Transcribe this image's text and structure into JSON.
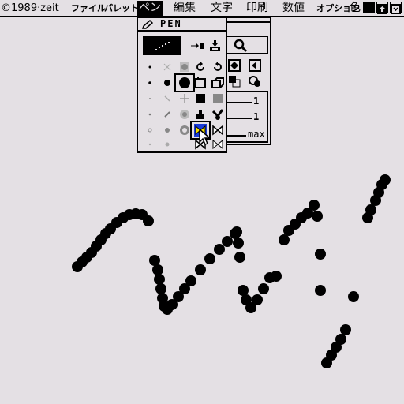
{
  "menubar": {
    "copyright": "©1989·zeit",
    "file": "ファイル",
    "palette": "パレット",
    "pen": "ペン",
    "edit": "編集",
    "text": "文字",
    "print": "印刷",
    "numeric": "数値",
    "option": "オプション",
    "color": "色"
  },
  "pen_palette": {
    "title": "PEN"
  },
  "settings": {
    "value1": "1",
    "value2": "1",
    "max_label": "max"
  }
}
